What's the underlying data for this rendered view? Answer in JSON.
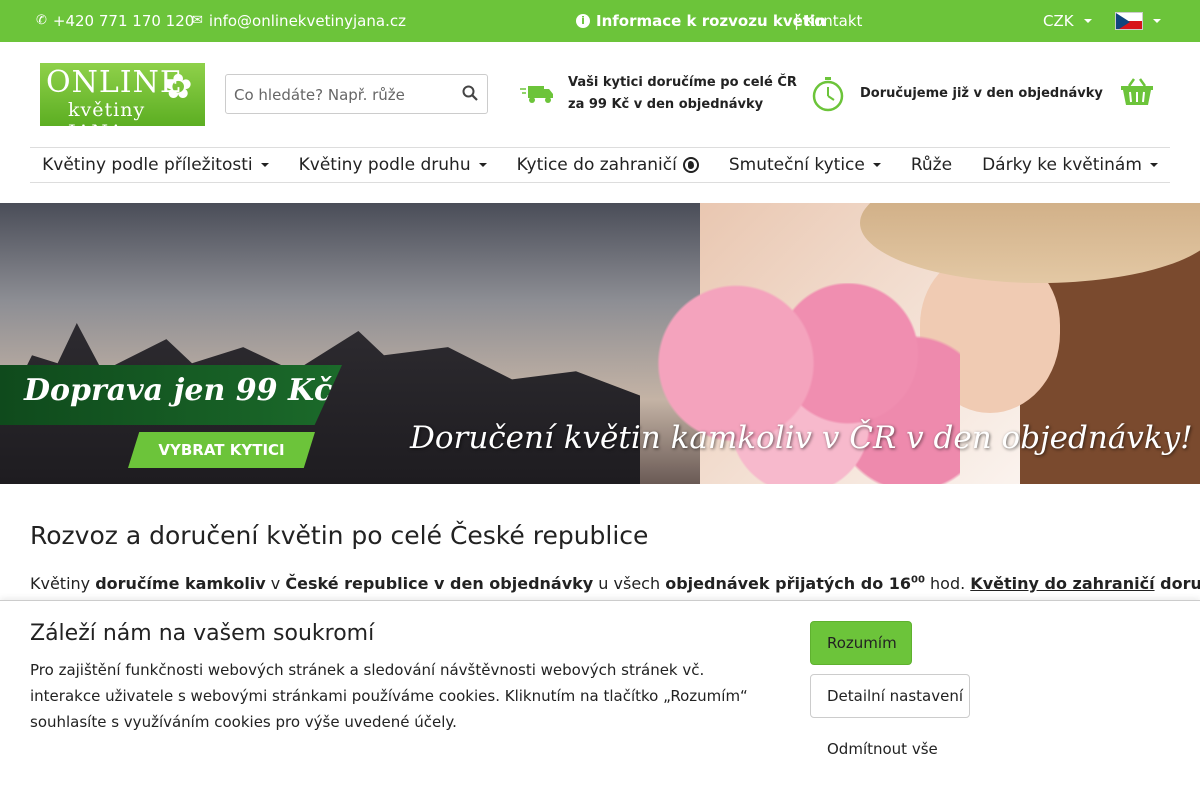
{
  "topbar": {
    "phone": "+420 771 170 120",
    "email": "info@onlinekvetinyjana.cz",
    "delivery_info": "Informace k rozvozu květin",
    "separator": "|",
    "contact": "Kontakt",
    "currency": "CZK",
    "language_flag": "flag-cz"
  },
  "header": {
    "logo_line1": "ONLINE",
    "logo_line2": "květiny JANA",
    "search_placeholder": "Co hledáte? Např. růže",
    "feature1_line1": "Vaši kytici doručíme po celé ČR",
    "feature1_line2": "za 99 Kč v den objednávky",
    "feature2": "Doručujeme již v den objednávky",
    "basket_icon": "basket-icon"
  },
  "nav": {
    "items": [
      {
        "label": "Květiny podle příležitosti",
        "dropdown": true
      },
      {
        "label": "Květiny podle druhu",
        "dropdown": true
      },
      {
        "label": "Kytice do zahraničí",
        "dropdown": false,
        "icon": "globe-icon"
      },
      {
        "label": "Smuteční kytice",
        "dropdown": true
      },
      {
        "label": "Růže",
        "dropdown": false
      },
      {
        "label": "Dárky ke květinám",
        "dropdown": true
      }
    ]
  },
  "banner": {
    "promo": "Doprava jen 99 Kč",
    "cta": "VYBRAT KYTICI",
    "tagline": "Doručení květin kamkoliv v ČR v den objednávky!"
  },
  "content": {
    "heading": "Rozvoz a doručení květin po celé České republice",
    "p_1": "Květiny ",
    "p_2": "doručíme kamkoliv",
    "p_3": " v ",
    "p_4": "České republice v den objednávky",
    "p_5": " u všech ",
    "p_6": "objednávek přijatých do 16",
    "p_sup": "00",
    "p_7": " hod. ",
    "p_link": "Květiny do zahraničí",
    "p_8": " doručíme"
  },
  "cookie": {
    "title": "Záleží nám na vašem soukromí",
    "text": "Pro zajištění funkčnosti webových stránek a sledování návštěvnosti webových stránek vč. interakce uživatele s webovými stránkami používáme cookies. Kliknutím na tlačítko „Rozumím“ souhlasíte s využíváním cookies pro výše uvedené účely.",
    "accept": "Rozumím",
    "details": "Detailní nastavení",
    "reject": "Odmítnout vše"
  },
  "colors": {
    "brand_green": "#6cc43a",
    "dark_green": "#1b6a2a"
  }
}
